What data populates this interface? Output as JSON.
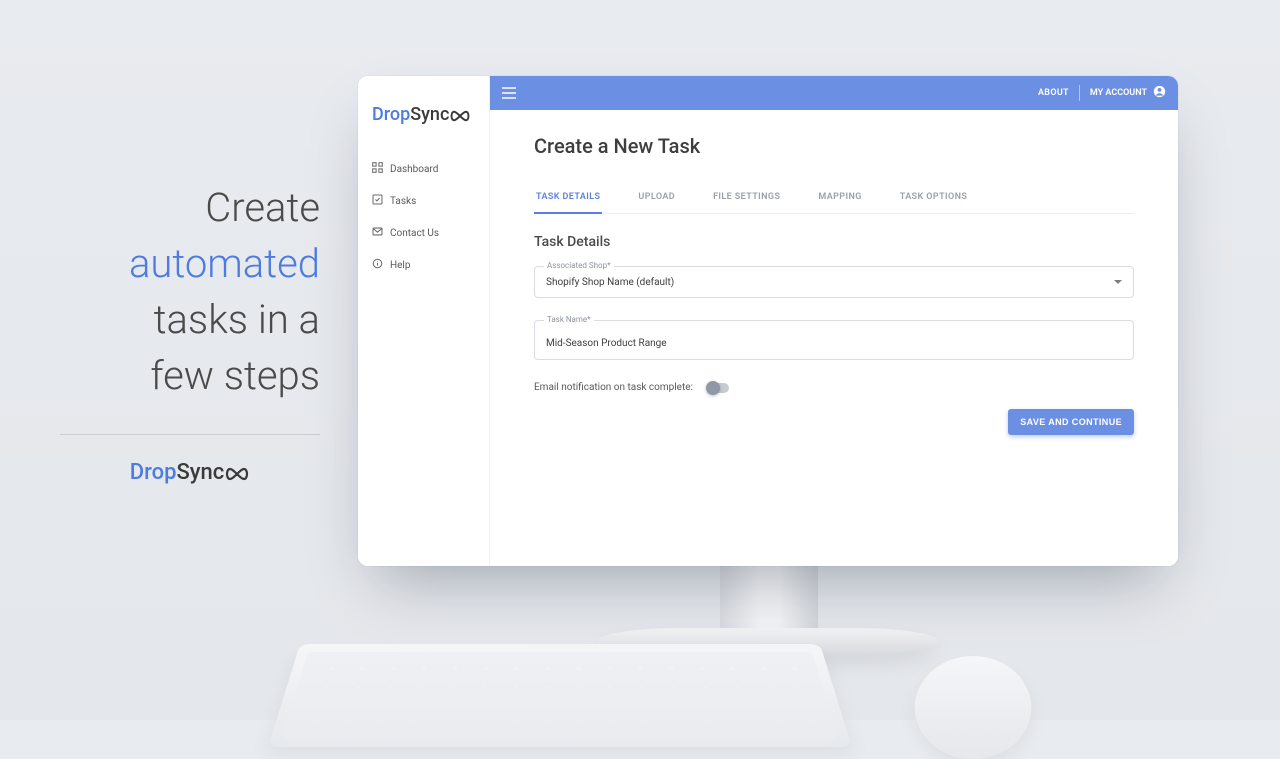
{
  "marketing": {
    "line1": "Create",
    "line2_accent": "automated",
    "line3": "tasks in a",
    "line4": "few steps"
  },
  "brand": {
    "part1": "Drop",
    "part2": "Sync"
  },
  "topbar": {
    "about": "ABOUT",
    "my_account": "MY ACCOUNT"
  },
  "sidebar": {
    "items": [
      {
        "label": "Dashboard",
        "icon": "grid"
      },
      {
        "label": "Tasks",
        "icon": "check-square"
      },
      {
        "label": "Contact Us",
        "icon": "mail"
      },
      {
        "label": "Help",
        "icon": "info"
      }
    ]
  },
  "page": {
    "title": "Create a New Task",
    "tabs": [
      {
        "label": "TASK DETAILS",
        "active": true
      },
      {
        "label": "UPLOAD",
        "active": false
      },
      {
        "label": "FILE SETTINGS",
        "active": false
      },
      {
        "label": "MAPPING",
        "active": false
      },
      {
        "label": "TASK OPTIONS",
        "active": false
      }
    ],
    "section_title": "Task Details",
    "fields": {
      "associated_shop": {
        "label": "Associated Shop*",
        "value": "Shopify Shop Name (default)"
      },
      "task_name": {
        "label": "Task Name*",
        "value": "Mid-Season Product Range"
      }
    },
    "email_toggle_label": "Email notification on task complete:",
    "email_toggle_on": false,
    "save_button": "SAVE AND CONTINUE"
  }
}
